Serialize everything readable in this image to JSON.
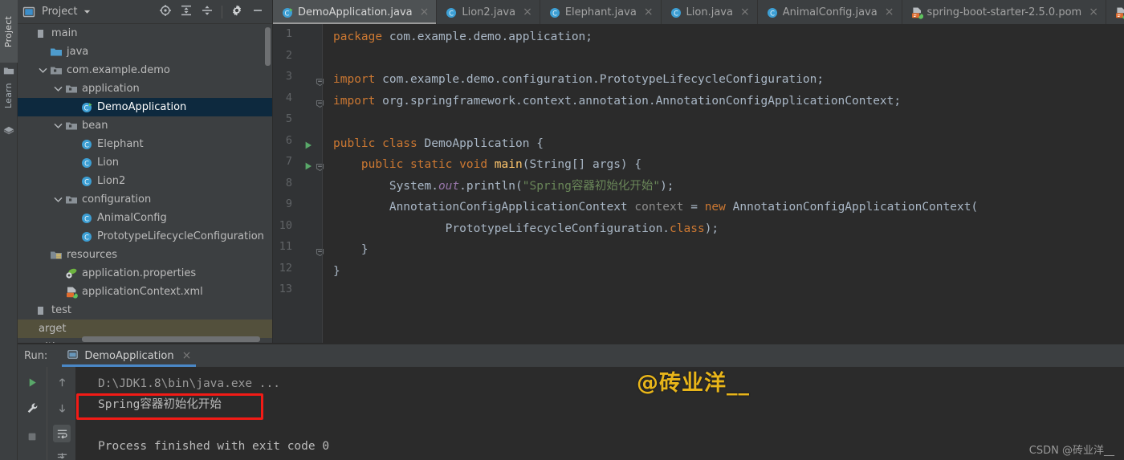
{
  "left_strip": {
    "tabs": [
      {
        "label": "Project",
        "icon": "project-icon",
        "selected": true
      },
      {
        "label": "Learn",
        "icon": "learn-icon",
        "selected": false
      }
    ]
  },
  "project_panel": {
    "title": "Project",
    "title_icon": "project-window-icon",
    "dropdown_icon": "chevron-down-icon",
    "actions": [
      {
        "name": "locate-icon",
        "tooltip": "Select Opened File"
      },
      {
        "name": "expand-all-icon",
        "tooltip": "Expand All"
      },
      {
        "name": "collapse-all-icon",
        "tooltip": "Collapse All"
      },
      {
        "name": "gear-icon",
        "tooltip": "Settings"
      },
      {
        "name": "minimize-icon",
        "tooltip": "Hide"
      }
    ],
    "tree": [
      {
        "label": "main",
        "indent": 0,
        "icon": "module-icon",
        "arrow": "none",
        "state": "normal"
      },
      {
        "label": "java",
        "indent": 1,
        "icon": "source-folder-icon",
        "arrow": "none",
        "state": "normal"
      },
      {
        "label": "com.example.demo",
        "indent": 1,
        "icon": "package-icon",
        "arrow": "expanded",
        "state": "normal"
      },
      {
        "label": "application",
        "indent": 2,
        "icon": "package-icon",
        "arrow": "expanded",
        "state": "normal"
      },
      {
        "label": "DemoApplication",
        "indent": 3,
        "icon": "java-class-run-icon",
        "arrow": "none",
        "state": "selected"
      },
      {
        "label": "bean",
        "indent": 2,
        "icon": "package-icon",
        "arrow": "expanded",
        "state": "normal"
      },
      {
        "label": "Elephant",
        "indent": 3,
        "icon": "java-class-icon",
        "arrow": "none",
        "state": "normal"
      },
      {
        "label": "Lion",
        "indent": 3,
        "icon": "java-class-icon",
        "arrow": "none",
        "state": "normal"
      },
      {
        "label": "Lion2",
        "indent": 3,
        "icon": "java-class-icon",
        "arrow": "none",
        "state": "normal"
      },
      {
        "label": "configuration",
        "indent": 2,
        "icon": "package-icon",
        "arrow": "expanded",
        "state": "normal"
      },
      {
        "label": "AnimalConfig",
        "indent": 3,
        "icon": "java-class-icon",
        "arrow": "none",
        "state": "normal"
      },
      {
        "label": "PrototypeLifecycleConfiguration",
        "indent": 3,
        "icon": "java-class-icon",
        "arrow": "none",
        "state": "normal"
      },
      {
        "label": "resources",
        "indent": 1,
        "icon": "resources-folder-icon",
        "arrow": "none",
        "state": "normal"
      },
      {
        "label": "application.properties",
        "indent": 2,
        "icon": "properties-file-icon",
        "arrow": "none",
        "state": "normal"
      },
      {
        "label": "applicationContext.xml",
        "indent": 2,
        "icon": "spring-xml-icon",
        "arrow": "none",
        "state": "normal"
      },
      {
        "label": "test",
        "indent": 0,
        "icon": "module-icon",
        "arrow": "none",
        "state": "normal"
      },
      {
        "label": "arget",
        "indent": 0,
        "icon": "none",
        "arrow": "none",
        "state": "excluded"
      },
      {
        "label": "nitignore",
        "indent": 0,
        "icon": "none",
        "arrow": "none",
        "state": "normal"
      }
    ]
  },
  "editor_tabs": [
    {
      "label": "DemoApplication.java",
      "icon": "java-class-run-icon",
      "active": true,
      "close": "×"
    },
    {
      "label": "Lion2.java",
      "icon": "java-class-icon",
      "active": false,
      "close": "×"
    },
    {
      "label": "Elephant.java",
      "icon": "java-class-icon",
      "active": false,
      "close": "×"
    },
    {
      "label": "Lion.java",
      "icon": "java-class-icon",
      "active": false,
      "close": "×"
    },
    {
      "label": "AnimalConfig.java",
      "icon": "java-class-icon",
      "active": false,
      "close": "×"
    },
    {
      "label": "spring-boot-starter-2.5.0.pom",
      "icon": "maven-pom-icon",
      "active": false,
      "close": "×"
    },
    {
      "label": "",
      "icon": "maven-pom-icon",
      "active": false,
      "close": ""
    }
  ],
  "editor": {
    "line_numbers": [
      "1",
      "2",
      "3",
      "4",
      "5",
      "6",
      "7",
      "8",
      "9",
      "10",
      "11",
      "12",
      "13"
    ],
    "run_markers": [
      6,
      7
    ],
    "fold_markers": [
      3,
      4,
      7,
      11
    ],
    "lines": [
      {
        "n": 1,
        "tokens": [
          {
            "t": "package ",
            "c": "kw"
          },
          {
            "t": "com.example.demo.application;",
            "c": "plain"
          }
        ]
      },
      {
        "n": 2,
        "tokens": []
      },
      {
        "n": 3,
        "tokens": [
          {
            "t": "import ",
            "c": "kw"
          },
          {
            "t": "com.example.demo.configuration.PrototypeLifecycleConfiguration;",
            "c": "plain"
          }
        ]
      },
      {
        "n": 4,
        "tokens": [
          {
            "t": "import ",
            "c": "kw"
          },
          {
            "t": "org.springframework.context.annotation.AnnotationConfigApplicationContext;",
            "c": "plain"
          }
        ]
      },
      {
        "n": 5,
        "tokens": []
      },
      {
        "n": 6,
        "tokens": [
          {
            "t": "public class ",
            "c": "kw"
          },
          {
            "t": "DemoApplication ",
            "c": "plain"
          },
          {
            "t": "{",
            "c": "plain"
          }
        ]
      },
      {
        "n": 7,
        "tokens": [
          {
            "t": "    ",
            "c": "plain"
          },
          {
            "t": "public static void ",
            "c": "kw"
          },
          {
            "t": "main",
            "c": "fn"
          },
          {
            "t": "(String[] args) {",
            "c": "plain"
          }
        ]
      },
      {
        "n": 8,
        "tokens": [
          {
            "t": "        System.",
            "c": "plain"
          },
          {
            "t": "out",
            "c": "field"
          },
          {
            "t": ".println(",
            "c": "plain"
          },
          {
            "t": "\"Spring容器初始化开始\"",
            "c": "str"
          },
          {
            "t": ");",
            "c": "plain"
          }
        ]
      },
      {
        "n": 9,
        "tokens": [
          {
            "t": "        AnnotationConfigApplicationContext ",
            "c": "plain"
          },
          {
            "t": "context",
            "c": "local"
          },
          {
            "t": " = ",
            "c": "plain"
          },
          {
            "t": "new ",
            "c": "kw"
          },
          {
            "t": "AnnotationConfigApplicationContext(",
            "c": "plain"
          }
        ]
      },
      {
        "n": 10,
        "tokens": [
          {
            "t": "                PrototypeLifecycleConfiguration.",
            "c": "plain"
          },
          {
            "t": "class",
            "c": "kw"
          },
          {
            "t": ");",
            "c": "plain"
          }
        ]
      },
      {
        "n": 11,
        "tokens": [
          {
            "t": "    }",
            "c": "plain"
          }
        ]
      },
      {
        "n": 12,
        "tokens": [
          {
            "t": "}",
            "c": "plain"
          }
        ]
      },
      {
        "n": 13,
        "tokens": []
      }
    ]
  },
  "run_panel": {
    "label": "Run:",
    "tab": {
      "label": "DemoApplication",
      "icon": "run-config-icon",
      "close": "×"
    },
    "buttons": [
      {
        "name": "rerun-button",
        "icon": "play-icon"
      },
      {
        "name": "settings-wrench-button",
        "icon": "wrench-icon"
      },
      {
        "name": "stop-button",
        "icon": "stop-icon"
      },
      {
        "name": "scroll-up-button",
        "icon": "arrow-up-icon"
      },
      {
        "name": "scroll-down-button",
        "icon": "arrow-down-icon"
      },
      {
        "name": "soft-wrap-button",
        "icon": "soft-wrap-icon"
      },
      {
        "name": "scroll-to-end-button",
        "icon": "scroll-end-icon"
      }
    ],
    "console_lines": [
      {
        "text": "D:\\JDK1.8\\bin\\java.exe ...",
        "style": "dim"
      },
      {
        "text": "Spring容器初始化开始",
        "style": "normal"
      },
      {
        "text": "",
        "style": "normal"
      },
      {
        "text": "Process finished with exit code 0",
        "style": "normal"
      }
    ]
  },
  "annotations": {
    "watermark": "@砖业洋__",
    "watermark_color": "#e8b51a",
    "footer": "CSDN @砖业洋__",
    "highlight_color": "#f21b16"
  }
}
